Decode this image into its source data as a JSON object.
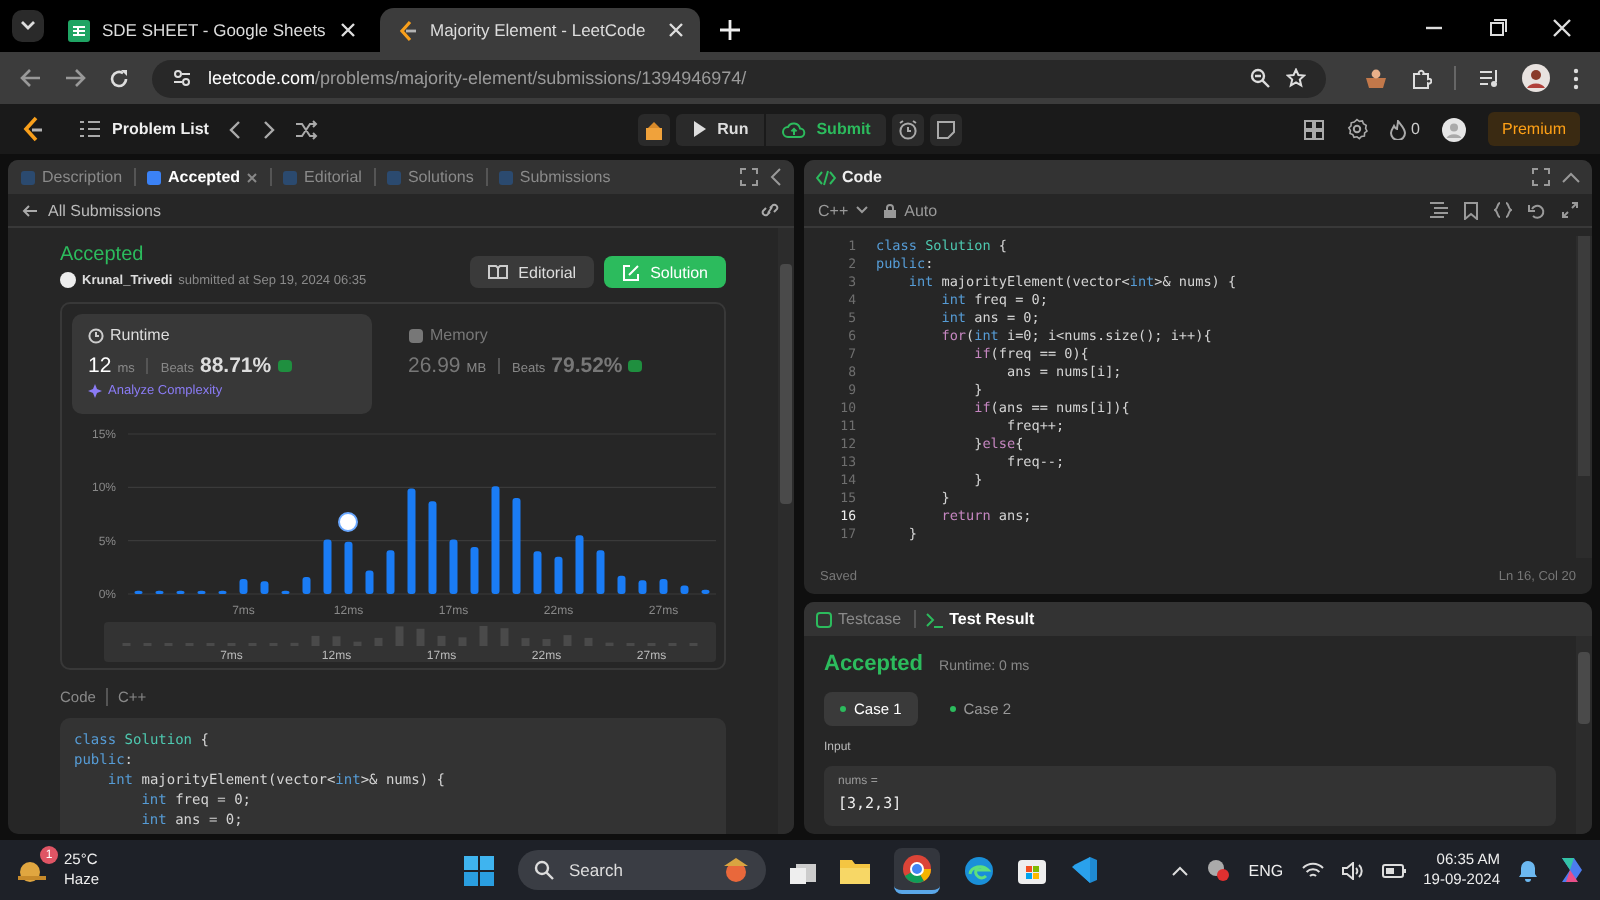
{
  "browser": {
    "tabs": [
      {
        "title": "SDE SHEET - Google Sheets",
        "kind": "sheets",
        "selected": false
      },
      {
        "title": "Majority Element - LeetCode",
        "kind": "leetcode",
        "selected": true
      }
    ],
    "url_host": "leetcode.com",
    "url_path": "/problems/majority-element/submissions/1394946974/"
  },
  "toolbar": {
    "problem_list": "Problem List",
    "run": "Run",
    "submit": "Submit",
    "streak": "0",
    "premium": "Premium"
  },
  "left_tabs": [
    {
      "label": "Description",
      "selected": false
    },
    {
      "label": "Accepted",
      "selected": true
    },
    {
      "label": "Editorial",
      "selected": false
    },
    {
      "label": "Solutions",
      "selected": false
    },
    {
      "label": "Submissions",
      "selected": false
    }
  ],
  "back_link": "All Submissions",
  "submission": {
    "status": "Accepted",
    "user": "Krunal_Trivedi",
    "submitted": "submitted at Sep 19, 2024 06:35",
    "editorial_button": "Editorial",
    "solution_button": "Solution"
  },
  "stats": [
    {
      "label": "Runtime",
      "value": "12",
      "unit": "ms",
      "beats_label": "Beats",
      "beats": "88.71%",
      "selected": true,
      "link": "Analyze Complexity"
    },
    {
      "label": "Memory",
      "value": "26.99",
      "unit": "MB",
      "beats_label": "Beats",
      "beats": "79.52%",
      "selected": false
    }
  ],
  "chart_data": {
    "type": "bar",
    "x": [
      2,
      3,
      4,
      5,
      6,
      7,
      8,
      9,
      10,
      11,
      12,
      13,
      14,
      15,
      16,
      17,
      18,
      19,
      20,
      21,
      22,
      23,
      24,
      25,
      26,
      27,
      28,
      29
    ],
    "values": [
      0.3,
      0.3,
      0.3,
      0.3,
      0.3,
      1.4,
      1.2,
      0.3,
      1.6,
      5.1,
      4.9,
      2.2,
      4.1,
      9.9,
      8.7,
      5.1,
      4.4,
      10.1,
      9.0,
      4.0,
      3.5,
      5.5,
      4.1,
      1.7,
      1.3,
      1.4,
      0.8,
      0.4
    ],
    "xlim": [
      1.5,
      29.5
    ],
    "ylim": [
      0,
      15
    ],
    "yticks": [
      {
        "value": 0,
        "label": "0%"
      },
      {
        "value": 5,
        "label": "5%"
      },
      {
        "value": 10,
        "label": "10%"
      },
      {
        "value": 15,
        "label": "15%"
      }
    ],
    "xticks": [
      {
        "value": 7,
        "label": "7ms"
      },
      {
        "value": 12,
        "label": "12ms"
      },
      {
        "value": 17,
        "label": "17ms"
      },
      {
        "value": 22,
        "label": "22ms"
      },
      {
        "value": 27,
        "label": "27ms"
      }
    ]
  },
  "navigator_labels": [
    "7ms",
    "12ms",
    "17ms",
    "22ms",
    "27ms"
  ],
  "code_view": {
    "label": "Code",
    "language": "C++",
    "lines": [
      "class Solution {",
      "public:",
      "    int majorityElement(vector<int>& nums) {",
      "        int freq = 0;",
      "        int ans = 0;"
    ]
  },
  "editor": {
    "title": "Code",
    "language": "C++",
    "mode": "Auto",
    "status": "Saved",
    "cursor": "Ln 16, Col 20",
    "lines": [
      {
        "number": "1",
        "code": "class Solution {",
        "selected": false
      },
      {
        "number": "2",
        "code": "public:",
        "selected": false
      },
      {
        "number": "3",
        "code": "    int majorityElement(vector<int>& nums) {",
        "selected": false
      },
      {
        "number": "4",
        "code": "        int freq = 0;",
        "selected": false
      },
      {
        "number": "5",
        "code": "        int ans = 0;",
        "selected": false
      },
      {
        "number": "6",
        "code": "        for(int i=0; i<nums.size(); i++){",
        "selected": false
      },
      {
        "number": "7",
        "code": "            if(freq == 0){",
        "selected": false
      },
      {
        "number": "8",
        "code": "                ans = nums[i];",
        "selected": false
      },
      {
        "number": "9",
        "code": "            }",
        "selected": false
      },
      {
        "number": "10",
        "code": "            if(ans == nums[i]){",
        "selected": false
      },
      {
        "number": "11",
        "code": "                freq++;",
        "selected": false
      },
      {
        "number": "12",
        "code": "            }else{",
        "selected": false
      },
      {
        "number": "13",
        "code": "                freq--;",
        "selected": false
      },
      {
        "number": "14",
        "code": "            }",
        "selected": false
      },
      {
        "number": "15",
        "code": "        }",
        "selected": false
      },
      {
        "number": "16",
        "code": "        return ans;",
        "selected": true
      },
      {
        "number": "17",
        "code": "    }",
        "selected": false
      }
    ]
  },
  "result_tabs": [
    {
      "label": "Testcase",
      "selected": false
    },
    {
      "label": "Test Result",
      "selected": true
    }
  ],
  "result": {
    "status": "Accepted",
    "runtime": "Runtime: 0 ms",
    "cases": [
      {
        "label": "Case 1",
        "selected": true
      },
      {
        "label": "Case 2",
        "selected": false
      }
    ],
    "input_label": "Input",
    "param_name": "nums =",
    "param_value": "[3,2,3]"
  },
  "taskbar": {
    "temperature": "25°C",
    "condition": "Haze",
    "badge": "1",
    "search": "Search",
    "language": "ENG",
    "time": "06:35 AM",
    "date": "19-09-2024"
  }
}
